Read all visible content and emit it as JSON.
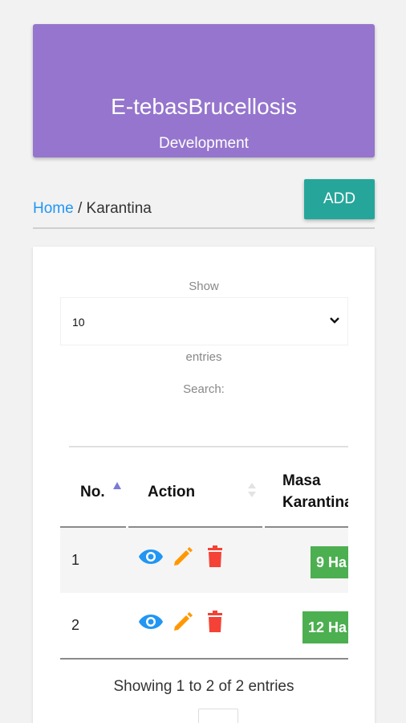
{
  "header": {
    "title": "E-tebasBrucellosis",
    "subtitle": "Development",
    "color": "#9575cd"
  },
  "toolbar": {
    "add_label": "ADD",
    "add_color": "#26a69a"
  },
  "breadcrumb": {
    "home": "Home",
    "separator": " / ",
    "current": "Karantina"
  },
  "table_controls": {
    "show_label": "Show",
    "page_length": "10",
    "entries_label": "entries",
    "search_label": "Search:"
  },
  "table": {
    "columns": [
      "No.",
      "Action",
      "Masa Karantina"
    ],
    "rows": [
      {
        "no": "1",
        "masa": "9 Ha"
      },
      {
        "no": "2",
        "masa": "12 Ha"
      }
    ],
    "action_icons": [
      "eye-icon",
      "pencil-icon",
      "trash-icon"
    ],
    "badge_color": "#4caf50"
  },
  "footer": {
    "info": "Showing 1 to 2 of 2 entries"
  }
}
